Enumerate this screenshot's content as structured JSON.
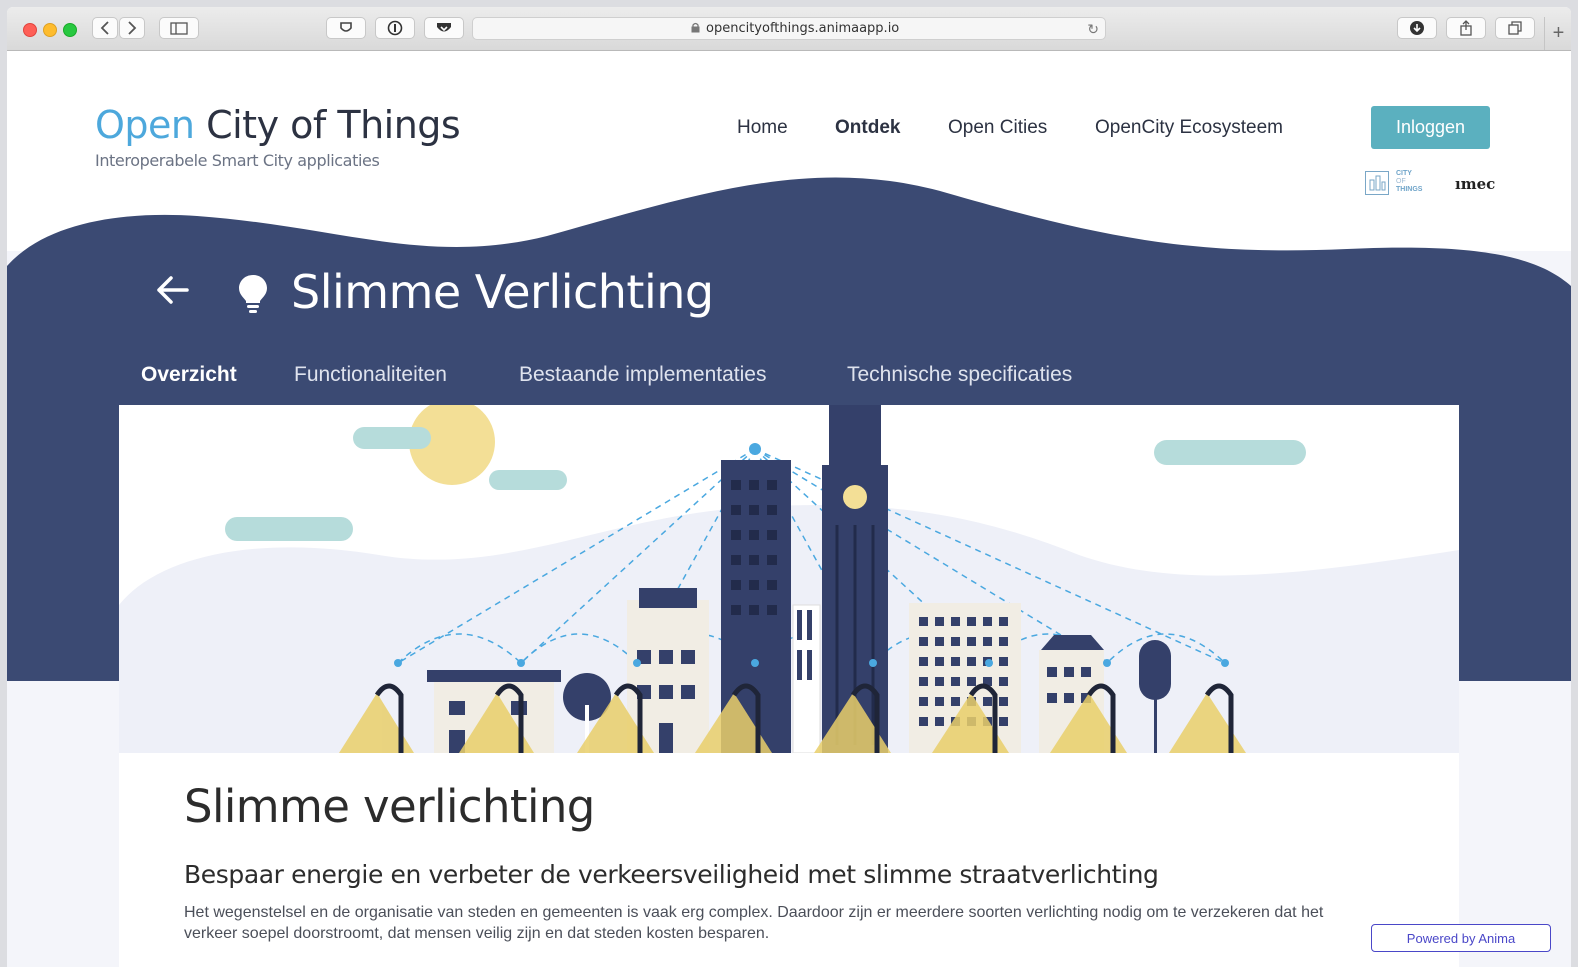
{
  "browser": {
    "url": "opencityofthings.animaapp.io"
  },
  "header": {
    "logo_accent": "Open",
    "logo_rest": "City of Things",
    "tagline": "Interoperabele Smart City applicaties",
    "nav": [
      {
        "label": "Home",
        "active": false
      },
      {
        "label": "Ontdek",
        "active": true
      },
      {
        "label": "Open Cities",
        "active": false
      },
      {
        "label": "OpenCity Ecosysteem",
        "active": false
      }
    ],
    "login_label": "Inloggen",
    "partners": {
      "cot_line1": "CITY",
      "cot_line2": "OF",
      "cot_line3": "THINGS",
      "imec": "ımec"
    }
  },
  "hero": {
    "title": "Slimme Verlichting",
    "back_icon": "arrow-left-icon",
    "title_icon": "lightbulb-icon",
    "tabs": [
      {
        "label": "Overzicht",
        "active": true
      },
      {
        "label": "Functionaliteiten",
        "active": false
      },
      {
        "label": "Bestaande implementaties",
        "active": false
      },
      {
        "label": "Technische specificaties",
        "active": false
      }
    ]
  },
  "content": {
    "heading": "Slimme verlichting",
    "subheading": "Bespaar energie en verbeter de verkeersveiligheid met slimme straatverlichting",
    "paragraph": "Het wegenstelsel en de organisatie van steden en gemeenten is vaak erg complex. Daardoor zijn er meerdere soorten verlichting nodig om te verzekeren dat het verkeer soepel doorstroomt, dat mensen veilig zijn en dat steden kosten besparen."
  },
  "badge": {
    "label": "Powered by Anima"
  },
  "colors": {
    "accent_blue": "#4da8dc",
    "navy": "#3b4a73",
    "login_teal": "#5bb0bf",
    "anima_purple": "#4a47c8",
    "light_yellow": "#f0d27a"
  }
}
